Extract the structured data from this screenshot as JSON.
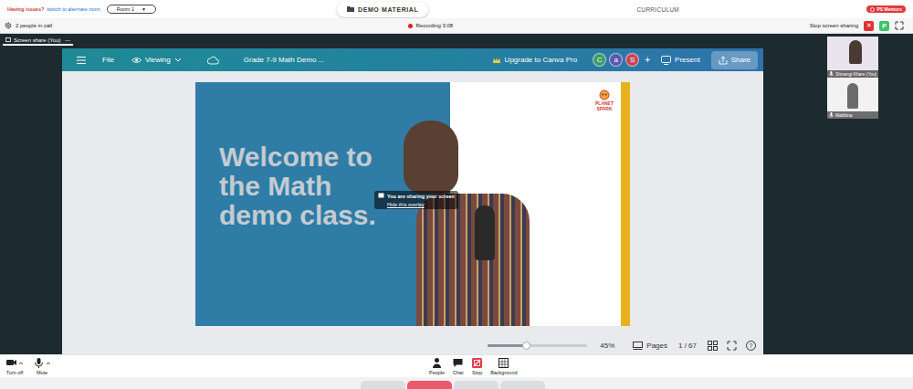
{
  "top_bar": {
    "issue_text": "Having issues?",
    "switch_link": "switch to alternate room",
    "room": "Room 1",
    "room_caret": "▼",
    "center_tab": "DEMO MATERIAL",
    "right_tab": "CURRICULUM",
    "badge": "PS Mentors"
  },
  "call_bar": {
    "people_count": "2 people in call",
    "recording": "Recording 3:08",
    "stop_sharing": "Stop screen sharing",
    "close": "✕",
    "participant_badge": "P"
  },
  "tabs": [
    {
      "label": "Screen share (You)",
      "selected": true
    }
  ],
  "tab_menu": "⋯",
  "canva": {
    "file": "File",
    "viewing": "Viewing",
    "title": "Grade 7-9 Math Demo ...",
    "upgrade": "Upgrade to Canva Pro",
    "avatars": [
      {
        "initial": "C",
        "color": "#3f9a6c"
      },
      {
        "initial": "a",
        "color": "#5b57b3"
      },
      {
        "initial": "S",
        "color": "#c4485a"
      }
    ],
    "add": "+",
    "present": "Present",
    "share": "Share",
    "slide": {
      "heading_lines": [
        "Welcome to",
        "the Math",
        "demo class."
      ],
      "logo_line1": "PLANET",
      "logo_line2": "SPARK"
    },
    "zoom": {
      "level": 0.38,
      "reading": "45%"
    },
    "pages": "Pages",
    "page_count": "1 / 67",
    "help": "?"
  },
  "overlay": {
    "message": "You are sharing your screen",
    "hide": "Hide this overlay"
  },
  "participants": [
    {
      "name": "Shivangi Khare (You)"
    },
    {
      "name": "Mabbina"
    }
  ],
  "toolbar": {
    "left": [
      {
        "label": "Turn off",
        "kind": "camera"
      },
      {
        "label": "Mute",
        "kind": "mic"
      }
    ],
    "center": [
      {
        "label": "People",
        "kind": "people"
      },
      {
        "label": "Chat",
        "kind": "chat"
      },
      {
        "label": "Stop",
        "kind": "stop"
      },
      {
        "label": "Background",
        "kind": "background"
      }
    ]
  },
  "bottom_tabs": [
    {
      "selected": false
    },
    {
      "selected": true
    },
    {
      "selected": false
    },
    {
      "selected": false
    }
  ]
}
